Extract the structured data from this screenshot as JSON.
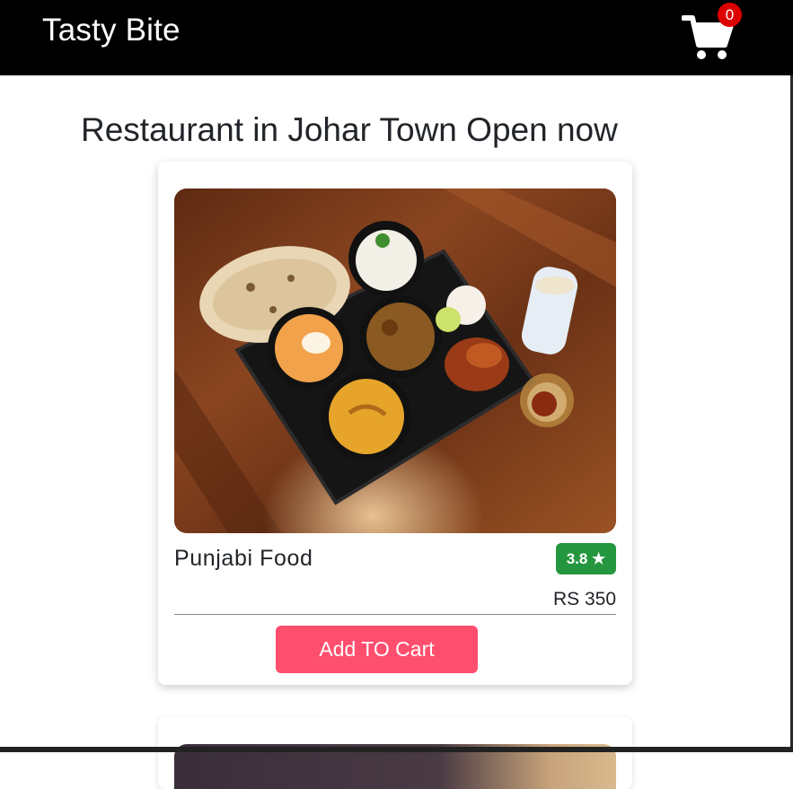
{
  "navbar": {
    "brand": "Tasty Bite",
    "cart_count": "0"
  },
  "page": {
    "heading": "Restaurant in Johar Town Open now"
  },
  "cards": [
    {
      "name": "Punjabi Food",
      "rating": "3.8 ★",
      "price": "RS 350",
      "add_label": "Add TO Cart",
      "image": "thali-platter-image"
    }
  ],
  "colors": {
    "navbar_bg": "#000000",
    "badge": "#dd0000",
    "rating_bg": "#24963f",
    "button_bg": "#ff4f6e"
  },
  "icons": {
    "cart": "shopping-cart-icon",
    "star": "star-icon"
  }
}
